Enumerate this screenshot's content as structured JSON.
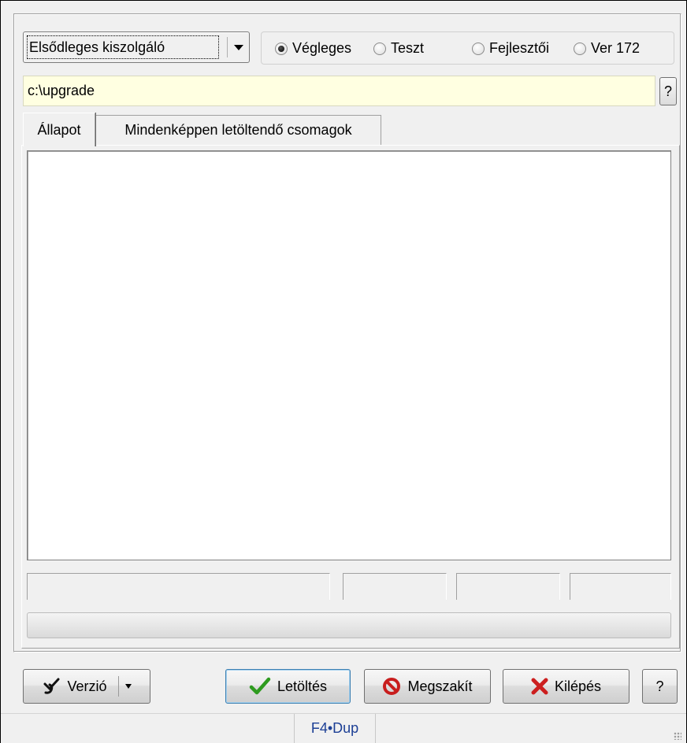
{
  "server_select": {
    "value": "Elsődleges kiszolgáló"
  },
  "release": {
    "options": [
      {
        "label": "Végleges",
        "checked": true
      },
      {
        "label": "Teszt",
        "checked": false
      },
      {
        "label": "Fejlesztői",
        "checked": false
      },
      {
        "label": "Ver 172",
        "checked": false
      }
    ]
  },
  "path": {
    "value": "c:\\upgrade",
    "help_label": "?"
  },
  "tabs": [
    {
      "label": "Állapot",
      "active": true
    },
    {
      "label": "Mindenképpen letöltendő csomagok",
      "active": false
    }
  ],
  "progress": {
    "value": 0
  },
  "buttons": {
    "version": "Verzió",
    "download": "Letöltés",
    "abort": "Megszakít",
    "exit": "Kilépés",
    "help": "?"
  },
  "statusbar": {
    "shortcut": "F4•Dup"
  },
  "colors": {
    "path_bg": "#ffffe1",
    "exit_icon": "#cc1f1f",
    "download_icon": "#2e9b1f",
    "abort_icon": "#c81e1e",
    "shortcut_text": "#1c3f95"
  }
}
